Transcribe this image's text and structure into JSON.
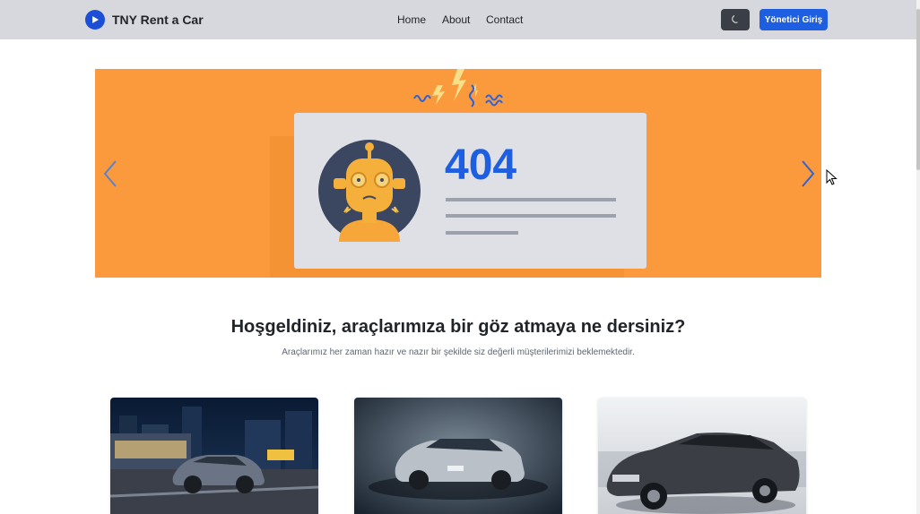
{
  "brand": {
    "name": "TNY Rent a Car",
    "icon": "play-circle-icon",
    "color": "#1d4fd6"
  },
  "nav": {
    "links": [
      {
        "label": "Home"
      },
      {
        "label": "About"
      },
      {
        "label": "Contact"
      }
    ],
    "theme_toggle_icon": "moon-icon",
    "admin_button_label": "Yönetici Giriş"
  },
  "carousel": {
    "background": "#fb9a3c",
    "slide": {
      "error_code": "404"
    },
    "prev_icon": "chevron-left-icon",
    "next_icon": "chevron-right-icon"
  },
  "welcome": {
    "title": "Hoşgeldiniz, araçlarımıza bir göz atmaya ne dersiniz?",
    "subtitle": "Araçlarımız her zaman hazır ve nazır bir şekilde siz değerli müşterilerimizi beklemektedir."
  },
  "cars": [
    {
      "image": "kia-stonic-night-city-photo"
    },
    {
      "image": "peugeot-301-studio-photo"
    },
    {
      "image": "citroen-c-elysee-studio-photo"
    }
  ]
}
